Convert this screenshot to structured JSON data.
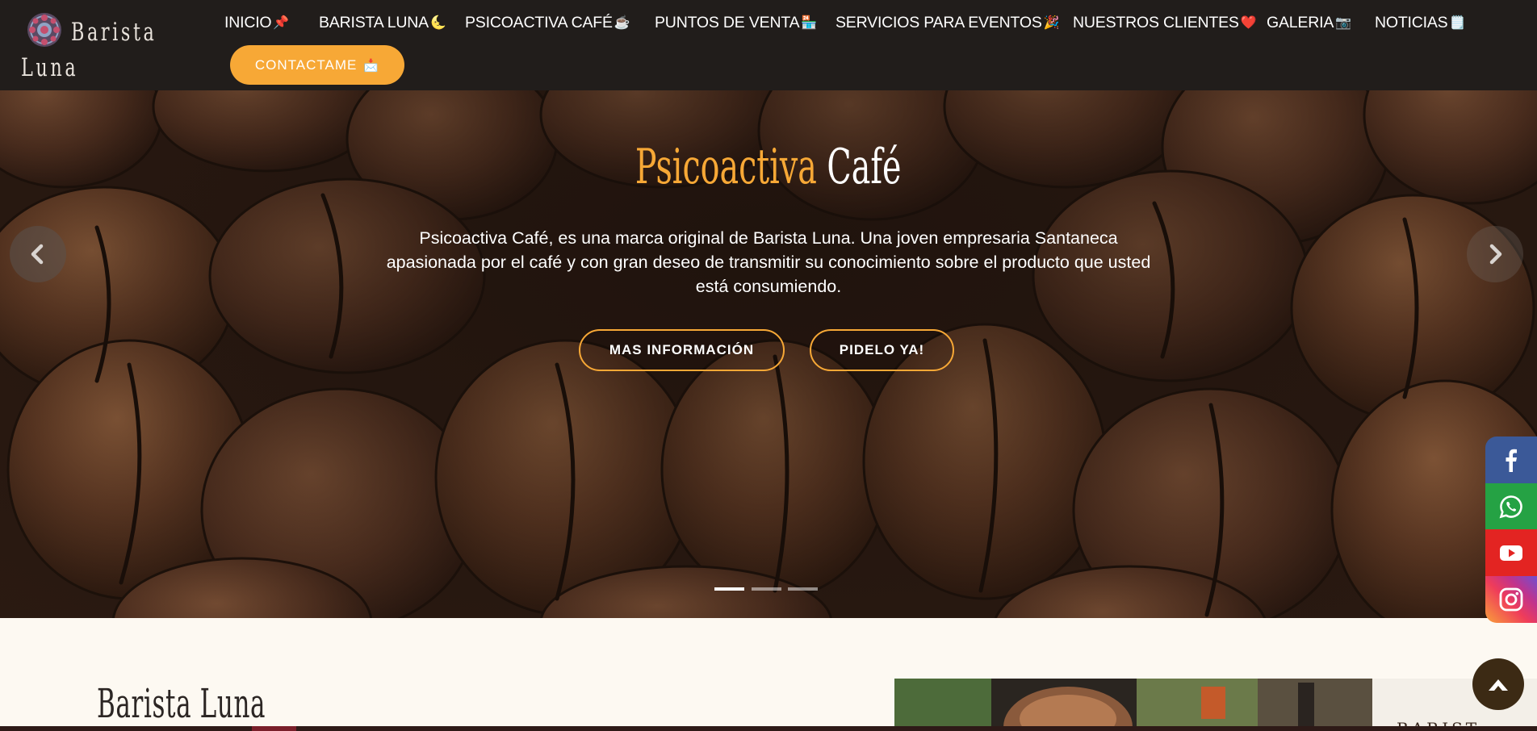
{
  "brand": {
    "line1": "Barista",
    "line2": "Luna"
  },
  "nav": {
    "items": [
      {
        "label": "INICIO",
        "emoji": "📌"
      },
      {
        "label": "BARISTA LUNA",
        "emoji": "🌜"
      },
      {
        "label": "PSICOACTIVA CAFÉ",
        "emoji": "☕"
      },
      {
        "label": "PUNTOS DE VENTA",
        "emoji": "🏪"
      },
      {
        "label": "SERVICIOS PARA EVENTOS",
        "emoji": "🎉"
      },
      {
        "label": "NUESTROS CLIENTES",
        "emoji": "❤️"
      },
      {
        "label": "GALERIA",
        "emoji": "📷"
      },
      {
        "label": "NOTICIAS",
        "emoji": "🗒️"
      }
    ],
    "contact": {
      "label": "CONTACTAME",
      "emoji": "📩"
    }
  },
  "hero": {
    "title_part1": "Psicoactiva",
    "title_part2": "Café",
    "text": "Psicoactiva Café, es una marca original de Barista Luna. Una joven empresaria Santaneca apasionada por el café y con gran deseo de transmitir su conocimiento sobre el producto que usted está consumiendo.",
    "button_info": "MAS INFORMACIÓN",
    "button_order": "PIDELO YA!",
    "active_slide": 1,
    "slide_count": 3
  },
  "section": {
    "heading": "Barista Luna",
    "photo_sign": "BARIST"
  },
  "social": [
    "facebook-icon",
    "whatsapp-icon",
    "youtube-icon",
    "instagram-icon"
  ],
  "colors": {
    "accent": "#f7a836",
    "navbar": "#211d1b",
    "facebook": "#3b5998",
    "whatsapp": "#25a244",
    "youtube": "#e32422",
    "back_to_top": "#3c2a14"
  }
}
